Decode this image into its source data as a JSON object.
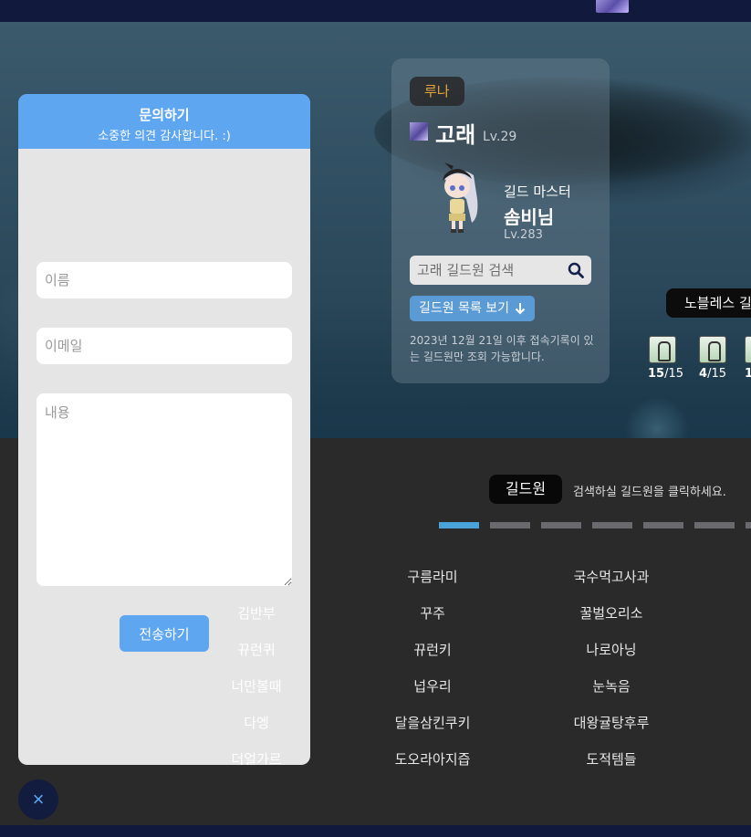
{
  "colors": {
    "accent": "#5ea6f0",
    "server_badge_text": "#e5a53a",
    "navy": "#11193d",
    "active_page": "#4aa3d8"
  },
  "guild": {
    "server": "루나",
    "name": "고래",
    "level": "Lv.29",
    "master_role": "길드 마스터",
    "master_name": "솜비님",
    "master_level": "Lv.283",
    "search_placeholder": "고래 길드원 검색",
    "member_list_label": "길드원 목록 보기",
    "note": "2023년 12월 21일 이후 접속기록이 있는 길드원만 조회 가능합니다."
  },
  "rank_tag": "노블레스 길",
  "boss_slots": [
    {
      "icon": "boss-character-icon",
      "count": "15",
      "max": "/15"
    },
    {
      "icon": "boss-character-icon",
      "count": "4",
      "max": "/15"
    },
    {
      "icon": "boss-character-icon",
      "count": "1",
      "max": ""
    }
  ],
  "members_section": {
    "tab_label": "길드원",
    "hint": "검색하실 길드원을 클릭하세요.",
    "pages_total": 7,
    "active_page": 1,
    "column_1": [
      "구름라미",
      "꾸주",
      "뀨런키",
      "넙우리",
      "달을삼킨쿠키",
      "도오라아지즙"
    ],
    "column_2": [
      "국수먹고사과",
      "꿀벌오리소",
      "나로아닝",
      "눈녹음",
      "대왕귤탕후루",
      "도적템들"
    ],
    "behind_modal": [
      "김반부",
      "뀨런퀴",
      "너만볼때",
      "다엥",
      "더얼가르"
    ]
  },
  "inquiry": {
    "title": "문의하기",
    "subtitle": "소중한 의견 감사합니다. :)",
    "name_placeholder": "이름",
    "email_placeholder": "이메일",
    "content_placeholder": "내용",
    "submit_label": "전송하기",
    "close_glyph": "×"
  }
}
